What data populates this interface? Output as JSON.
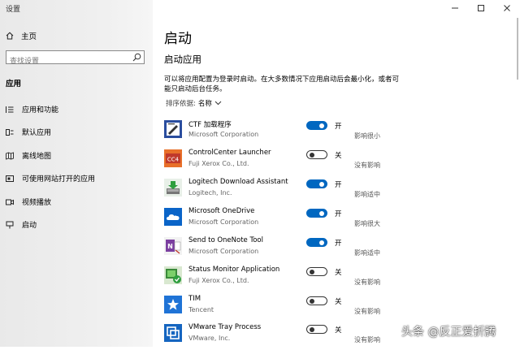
{
  "window": {
    "title": "设置"
  },
  "sidebar": {
    "home_label": "主页",
    "search_placeholder": "查找设置",
    "section_label": "应用",
    "items": [
      {
        "label": "应用和功能",
        "icon": "apps-list-icon"
      },
      {
        "label": "默认应用",
        "icon": "default-apps-icon"
      },
      {
        "label": "离线地图",
        "icon": "map-icon"
      },
      {
        "label": "可使用网站打开的应用",
        "icon": "website-apps-icon"
      },
      {
        "label": "视频播放",
        "icon": "video-icon"
      },
      {
        "label": "启动",
        "icon": "startup-icon"
      }
    ]
  },
  "main": {
    "title": "启动",
    "subtitle": "启动应用",
    "description": "可以将应用配置为登录时启动。在大多数情况下应用启动后会最小化，或者可能只启动后台任务。",
    "sort_label": "排序依据:",
    "sort_value": "名称"
  },
  "apps": [
    {
      "name": "CTF 加载程序",
      "publisher": "Microsoft Corporation",
      "enabled": true,
      "state": "开",
      "impact": "影响很小",
      "icon": "ctf-loader-icon"
    },
    {
      "name": "ControlCenter Launcher",
      "publisher": "Fuji Xerox Co., Ltd.",
      "enabled": false,
      "state": "关",
      "impact": "没有影响",
      "icon": "controlcenter-icon"
    },
    {
      "name": "Logitech Download Assistant",
      "publisher": "Logitech, Inc.",
      "enabled": true,
      "state": "开",
      "impact": "影响适中",
      "icon": "logitech-download-icon"
    },
    {
      "name": "Microsoft OneDrive",
      "publisher": "Microsoft Corporation",
      "enabled": true,
      "state": "开",
      "impact": "影响很大",
      "icon": "onedrive-cloud-icon"
    },
    {
      "name": "Send to OneNote Tool",
      "publisher": "Microsoft Corporation",
      "enabled": true,
      "state": "开",
      "impact": "影响适中",
      "icon": "onenote-icon"
    },
    {
      "name": "Status Monitor Application",
      "publisher": "Fuji Xerox Co., Ltd.",
      "enabled": false,
      "state": "关",
      "impact": "没有影响",
      "icon": "status-monitor-icon"
    },
    {
      "name": "TIM",
      "publisher": "Tencent",
      "enabled": false,
      "state": "关",
      "impact": "没有影响",
      "icon": "tim-star-icon"
    },
    {
      "name": "VMware Tray Process",
      "publisher": "VMware, Inc.",
      "enabled": false,
      "state": "关",
      "impact": "没有影响",
      "icon": "vmware-icon"
    }
  ],
  "watermark": "头条 @反正爱折腾",
  "colors": {
    "accent": "#0067c0",
    "sidebar_bg": "#ececec"
  }
}
